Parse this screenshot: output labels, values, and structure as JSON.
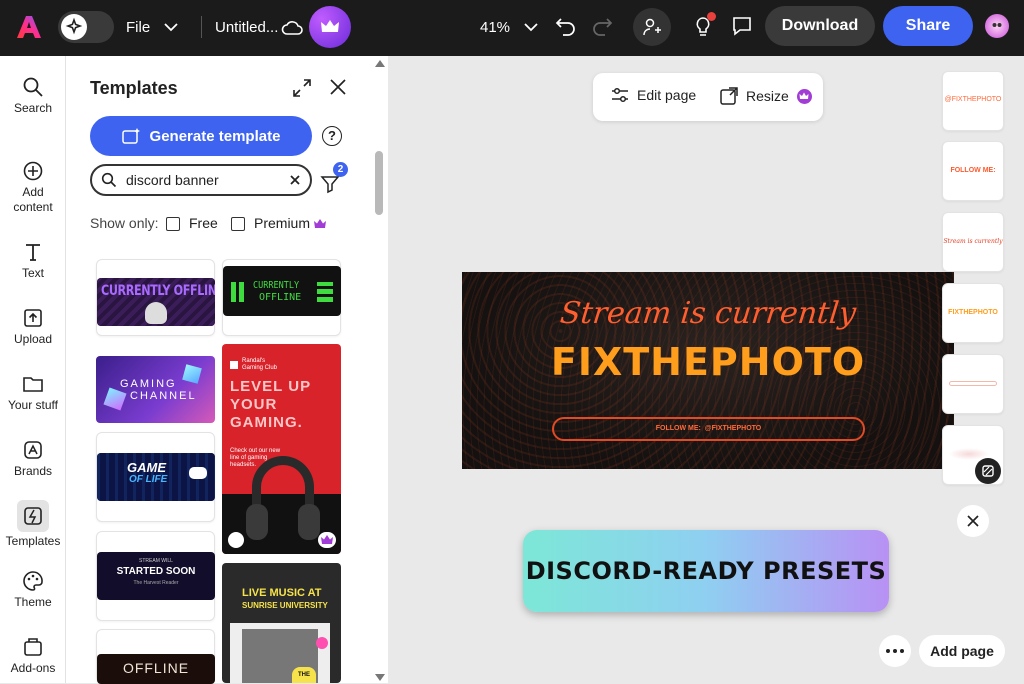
{
  "app": {
    "file_menu": "File",
    "doc_title": "Untitled...",
    "zoom": "41%",
    "download": "Download",
    "share": "Share",
    "colors": {
      "share_blue": "#3d63f0",
      "topbar": "#1b1b1b",
      "premium": "#a23cd7"
    }
  },
  "rail": [
    {
      "label": "Search",
      "icon": "search-icon"
    },
    {
      "label": "Add content",
      "icon": "plus-circle-icon"
    },
    {
      "label": "Text",
      "icon": "text-icon"
    },
    {
      "label": "Upload",
      "icon": "upload-icon"
    },
    {
      "label": "Your stuff",
      "icon": "folder-icon"
    },
    {
      "label": "Brands",
      "icon": "brand-icon"
    },
    {
      "label": "Templates",
      "icon": "templates-icon"
    },
    {
      "label": "Theme",
      "icon": "palette-icon"
    },
    {
      "label": "Add-ons",
      "icon": "addons-icon"
    }
  ],
  "panel": {
    "title": "Templates",
    "generate": "Generate template",
    "search_value": "discord banner",
    "filter_count": "2",
    "show_only": "Show only:",
    "free": "Free",
    "premium": "Premium"
  },
  "templates": {
    "t1": "CURRENTLY OFFLINE",
    "t2a": "CURRENTLY",
    "t2b": "OFFLINE",
    "t3a": "GAMING",
    "t3b": "CHANNEL",
    "t4a": "Randal's",
    "t4b": "Gaming Club",
    "t4c": "LEVEL UP",
    "t4d": "YOUR",
    "t4e": "GAMING.",
    "t4f": "Check out our new line of gaming headsets.",
    "t5a": "GAME",
    "t5b": "OF LIFE",
    "t6a": "STREAM WILL",
    "t6b": "STARTED SOON",
    "t6c": "The Harvest Reader",
    "t7a": "LIVE MUSIC AT",
    "t7b": "SUNRISE UNIVERSITY",
    "t7c": "THE",
    "t8": "OFFLINE"
  },
  "canvas": {
    "edit_page": "Edit page",
    "resize": "Resize",
    "script_line": "Stream is currently",
    "headline": "FIXTHEPHOTO",
    "follow": "FOLLOW ME:",
    "handle": "@FIXTHEPHOTO",
    "overlay": "DISCORD-READY PRESETS",
    "add_page": "Add page"
  },
  "pages": [
    {
      "label": "@FIXTHEPHOTO"
    },
    {
      "label": "FOLLOW ME:"
    },
    {
      "label": "Stream is currently"
    },
    {
      "label": "FIXTHEPHOTO"
    },
    {
      "label": ""
    },
    {
      "label": ""
    }
  ]
}
